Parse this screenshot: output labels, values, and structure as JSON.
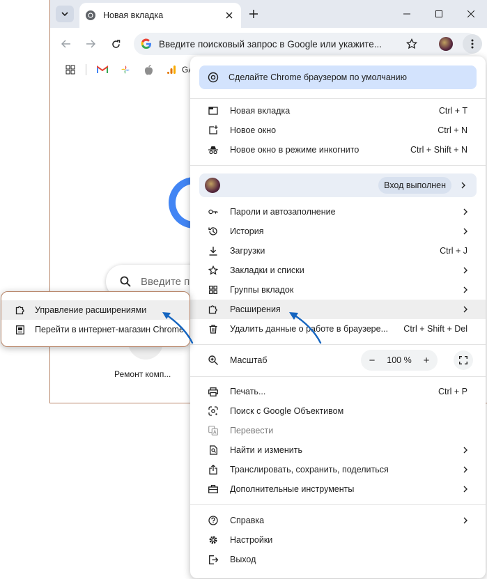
{
  "colors": {
    "accent": "#1a73e8",
    "promo_bg": "#d3e3fd",
    "arrow": "#1565c0",
    "titlebar": "#e5e9f0"
  },
  "tab": {
    "title": "Новая вкладка",
    "favicon": "chrome-icon"
  },
  "omnibox": {
    "placeholder": "Введите поисковый запрос в Google или укажите..."
  },
  "bookmarks": {
    "items": [
      "apps-icon",
      "gmail-icon",
      "photos-icon",
      "apple-icon",
      "analytics-icon"
    ],
    "partial_label": "GA"
  },
  "ntp": {
    "search_placeholder": "Введите п",
    "shortcut_label": "Ремонт комп..."
  },
  "menu": {
    "promo": "Сделайте Chrome браузером по умолчанию",
    "new_tab": {
      "label": "Новая вкладка",
      "shortcut": "Ctrl + T"
    },
    "new_window": {
      "label": "Новое окно",
      "shortcut": "Ctrl + N"
    },
    "incognito": {
      "label": "Новое окно в режиме инкогнито",
      "shortcut": "Ctrl + Shift + N"
    },
    "profile": {
      "status": "Вход выполнен"
    },
    "passwords": {
      "label": "Пароли и автозаполнение"
    },
    "history": {
      "label": "История"
    },
    "downloads": {
      "label": "Загрузки",
      "shortcut": "Ctrl + J"
    },
    "bookmarks": {
      "label": "Закладки и списки"
    },
    "tab_groups": {
      "label": "Группы вкладок"
    },
    "extensions": {
      "label": "Расширения"
    },
    "clear_data": {
      "label": "Удалить данные о работе в браузере...",
      "shortcut": "Ctrl + Shift + Del"
    },
    "zoom": {
      "label": "Масштаб",
      "value": "100 %",
      "minus": "−",
      "plus": "+"
    },
    "print": {
      "label": "Печать...",
      "shortcut": "Ctrl + P"
    },
    "lens": {
      "label": "Поиск с Google Объективом"
    },
    "translate": {
      "label": "Перевести"
    },
    "find": {
      "label": "Найти и изменить"
    },
    "cast": {
      "label": "Транслировать, сохранить, поделиться"
    },
    "more_tools": {
      "label": "Дополнительные инструменты"
    },
    "help": {
      "label": "Справка"
    },
    "settings": {
      "label": "Настройки"
    },
    "exit": {
      "label": "Выход"
    }
  },
  "submenu": {
    "manage": "Управление расширениями",
    "store": "Перейти в интернет-магазин Chrome"
  }
}
